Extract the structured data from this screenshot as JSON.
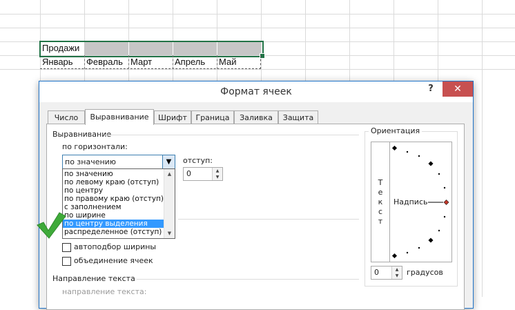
{
  "sheet": {
    "row1": [
      "Продажи"
    ],
    "row2": [
      "Январь",
      "Февраль",
      "Март",
      "Апрель",
      "Май"
    ]
  },
  "dialog": {
    "title": "Формат ячеек",
    "help": "?",
    "close": "✕",
    "tabs": [
      "Число",
      "Выравнивание",
      "Шрифт",
      "Граница",
      "Заливка",
      "Защита"
    ],
    "active_tab": "Выравнивание",
    "alignment": {
      "group_label": "Выравнивание",
      "horizontal_label": "по горизонтали:",
      "horizontal_value": "по значению",
      "indent_label": "отступ:",
      "indent_value": "0",
      "options": [
        "по значению",
        "по левому краю (отступ)",
        "по центру",
        "по правому краю (отступ)",
        "с заполнением",
        "по ширине",
        "по центру выделения",
        "распределенное (отступ)"
      ],
      "selected_option": "по центру выделения"
    },
    "display": {
      "autofit": "автоподбор ширины",
      "merge": "объединение ячеек"
    },
    "text_direction": {
      "group_label": "Направление текста",
      "direction_label": "направление текста:"
    },
    "orientation": {
      "group_label": "Ориентация",
      "vertical_text": [
        "Т",
        "е",
        "к",
        "с",
        "т"
      ],
      "dial_label": "Надпись",
      "degrees_value": "0",
      "degrees_label": "градусов"
    }
  },
  "colors": {
    "selection_border": "#217346",
    "dialog_border": "#1e73c8",
    "close_button": "#c75050",
    "list_highlight": "#3399ff",
    "check_mark": "#3faa3a"
  }
}
